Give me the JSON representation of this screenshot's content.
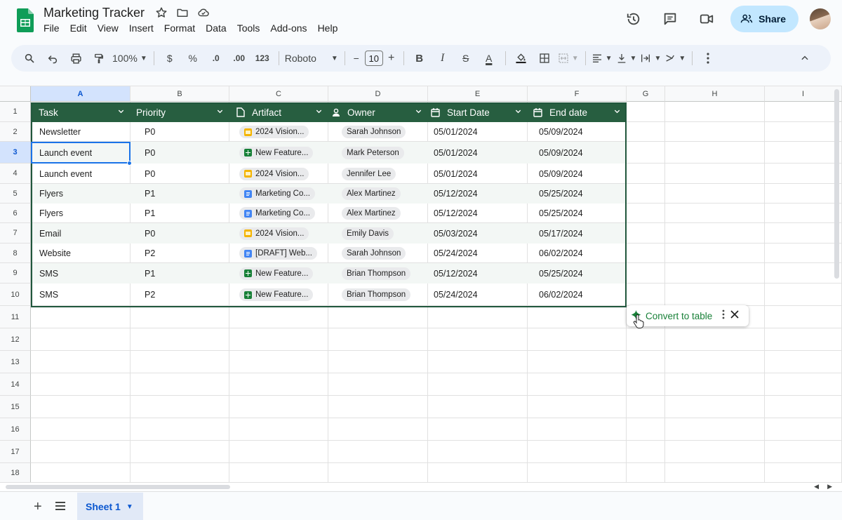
{
  "app": {
    "title": "Marketing Tracker",
    "menu": [
      "File",
      "Edit",
      "View",
      "Insert",
      "Format",
      "Data",
      "Tools",
      "Add-ons",
      "Help"
    ],
    "share_label": "Share"
  },
  "toolbar": {
    "zoom": "100%",
    "currency": "$",
    "percent": "%",
    "dec_decrease": ".0",
    "dec_increase": ".00",
    "number_format": "123",
    "font": "Roboto",
    "minus": "−",
    "font_size": "10",
    "plus": "+",
    "bold": "B",
    "italic": "I",
    "strike": "S",
    "text_color": "A"
  },
  "columns": [
    "A",
    "B",
    "C",
    "D",
    "E",
    "F",
    "G",
    "H",
    "I"
  ],
  "rows": [
    "1",
    "2",
    "3",
    "4",
    "5",
    "6",
    "7",
    "8",
    "9",
    "10",
    "11",
    "12",
    "13",
    "14",
    "15",
    "16",
    "17",
    "18"
  ],
  "table": {
    "headers": [
      "Task",
      "Priority",
      "Artifact",
      "Owner",
      "Start Date",
      "End date"
    ],
    "rows": [
      {
        "task": "Newsletter",
        "priority": "P0",
        "artifact": "2024 Vision...",
        "artifact_type": "slides",
        "owner": "Sarah Johnson",
        "start": "05/01/2024",
        "end": "05/09/2024"
      },
      {
        "task": "Launch event",
        "priority": "P0",
        "artifact": "New Feature...",
        "artifact_type": "sheets",
        "owner": "Mark Peterson",
        "start": "05/01/2024",
        "end": "05/09/2024"
      },
      {
        "task": "Launch event",
        "priority": "P0",
        "artifact": "2024 Vision...",
        "artifact_type": "slides",
        "owner": "Jennifer Lee",
        "start": "05/01/2024",
        "end": "05/09/2024"
      },
      {
        "task": "Flyers",
        "priority": "P1",
        "artifact": "Marketing Co...",
        "artifact_type": "docs",
        "owner": "Alex Martinez",
        "start": "05/12/2024",
        "end": "05/25/2024"
      },
      {
        "task": "Flyers",
        "priority": "P1",
        "artifact": "Marketing Co...",
        "artifact_type": "docs",
        "owner": "Alex Martinez",
        "start": "05/12/2024",
        "end": "05/25/2024"
      },
      {
        "task": "Email",
        "priority": "P0",
        "artifact": "2024 Vision...",
        "artifact_type": "slides",
        "owner": "Emily Davis",
        "start": "05/03/2024",
        "end": "05/17/2024"
      },
      {
        "task": "Website",
        "priority": "P2",
        "artifact": "[DRAFT] Web...",
        "artifact_type": "docs",
        "owner": "Sarah Johnson",
        "start": "05/24/2024",
        "end": "06/02/2024"
      },
      {
        "task": "SMS",
        "priority": "P1",
        "artifact": "New Feature...",
        "artifact_type": "sheets",
        "owner": "Brian Thompson",
        "start": "05/12/2024",
        "end": "05/25/2024"
      },
      {
        "task": "SMS",
        "priority": "P2",
        "artifact": "New Feature...",
        "artifact_type": "sheets",
        "owner": "Brian Thompson",
        "start": "05/24/2024",
        "end": "06/02/2024"
      }
    ]
  },
  "convert_popup": {
    "label": "Convert to table"
  },
  "sheet_tab": {
    "label": "Sheet 1"
  },
  "colors": {
    "table_header": "#275e40",
    "accent": "#188038",
    "selection": "#1a73e8",
    "share_bg": "#c2e7ff"
  },
  "icons": [
    "sheets-logo-icon",
    "star-icon",
    "folder-icon",
    "cloud-icon",
    "history-icon",
    "comment-icon",
    "video-icon",
    "people-icon",
    "search-icon",
    "undo-icon",
    "print-icon",
    "paint-format-icon",
    "text-color-icon",
    "fill-color-icon",
    "borders-icon",
    "merge-icon",
    "align-icon",
    "valign-icon",
    "wrap-icon",
    "rotate-icon",
    "more-icon",
    "collapse-icon",
    "calendar-icon",
    "person-icon",
    "file-icon",
    "sparkle-icon",
    "close-icon",
    "add-sheet-icon",
    "sheet-list-icon"
  ]
}
